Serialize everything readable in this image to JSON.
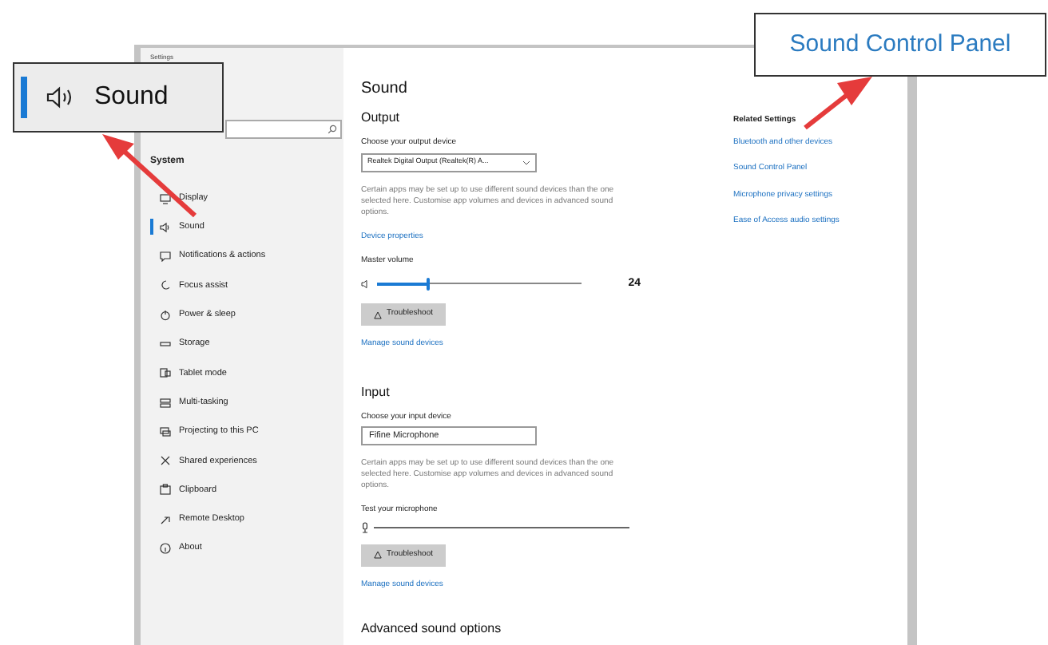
{
  "window": {
    "title": "Settings"
  },
  "callouts": [
    {
      "kind": "menu-item",
      "label": "Sound"
    },
    {
      "kind": "link",
      "label": "Sound Control Panel"
    }
  ],
  "sidebar": {
    "heading": "System",
    "items": [
      {
        "label": "Display",
        "selected": false
      },
      {
        "label": "Sound",
        "selected": true
      },
      {
        "label": "Notifications & actions",
        "selected": false
      },
      {
        "label": "Focus assist",
        "selected": false
      },
      {
        "label": "Power & sleep",
        "selected": false
      },
      {
        "label": "Storage",
        "selected": false
      },
      {
        "label": "Tablet mode",
        "selected": false
      },
      {
        "label": "Multi-tasking",
        "selected": false
      },
      {
        "label": "Projecting to this PC",
        "selected": false
      },
      {
        "label": "Shared experiences",
        "selected": false
      },
      {
        "label": "Clipboard",
        "selected": false
      },
      {
        "label": "Remote Desktop",
        "selected": false
      },
      {
        "label": "About",
        "selected": false
      }
    ]
  },
  "page_title": "Sound",
  "output": {
    "heading": "Output",
    "device_label": "Choose your output device",
    "device": "Realtek Digital Output (Realtek(R) A...",
    "note": "Certain apps may be set up to use different sound devices than the one selected here. Customise app volumes and devices in advanced sound options.",
    "properties_link": "Device properties",
    "volume_label": "Master volume",
    "volume": {
      "level": 0.25,
      "reading": "24"
    },
    "troubleshoot": "Troubleshoot",
    "manage_link": "Manage sound devices"
  },
  "input": {
    "heading": "Input",
    "device_label": "Choose your input device",
    "device": "Fifine Microphone",
    "note": "Certain apps may be set up to use different sound devices than the one selected here. Customise app volumes and devices in advanced sound options.",
    "test_label": "Test your microphone",
    "mic_meter": {
      "level": 0
    },
    "troubleshoot": "Troubleshoot",
    "manage_link": "Manage sound devices"
  },
  "advanced_heading": "Advanced sound options",
  "related": {
    "heading": "Related Settings",
    "links": [
      "Bluetooth and other devices",
      "Sound Control Panel",
      "Microphone privacy settings",
      "Ease of Access audio settings"
    ]
  }
}
